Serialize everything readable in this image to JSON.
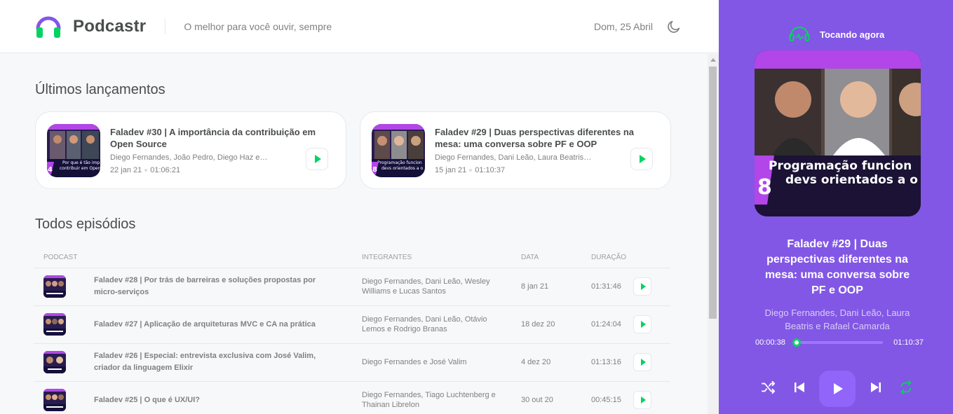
{
  "header": {
    "brand": "Podcastr",
    "tagline": "O melhor para você ouvir, sempre",
    "date": "Dom, 25 Abril",
    "theme_icon": "moon-icon",
    "logo_icon": "headphones-icon"
  },
  "latest": {
    "heading": "Últimos lançamentos",
    "episodes": [
      {
        "title": "Faladev #30 | A importância da contribuição em Open Source",
        "members": "Diego Fernandes, João Pedro, Diego Haz e Bruno Lemos",
        "date": "22 jan 21",
        "duration": "01:06:21",
        "thumb_number": "4"
      },
      {
        "title": "Faladev #29 | Duas perspectivas diferentes na mesa: uma conversa sobre PF e OOP",
        "members": "Diego Fernandes, Dani Leão, Laura Beatris e Rafael Camarda",
        "date": "15 jan 21",
        "duration": "01:10:37",
        "thumb_number": "8"
      }
    ]
  },
  "all": {
    "heading": "Todos episódios",
    "columns": {
      "podcast": "Podcast",
      "members": "Integrantes",
      "date": "Data",
      "duration": "Duração"
    },
    "episodes": [
      {
        "title": "Faladev #28 | Por trás de barreiras e soluções propostas por micro-serviços",
        "members": "Diego Fernandes, Dani Leão, Wesley Williams e Lucas Santos",
        "date": "8 jan 21",
        "duration": "01:31:46"
      },
      {
        "title": "Faladev #27 | Aplicação de arquiteturas MVC e CA na prática",
        "members": "Diego Fernandes, Dani Leão, Otávio Lemos e Rodrigo Branas",
        "date": "18 dez 20",
        "duration": "01:24:04"
      },
      {
        "title": "Faladev #26 | Especial: entrevista exclusiva com José Valim, criador da linguagem Elixir",
        "members": "Diego Fernandes e José Valim",
        "date": "4 dez 20",
        "duration": "01:13:16"
      },
      {
        "title": "Faladev #25 | O que é UX/UI?",
        "members": "Diego Fernandes, Tiago Luchtenberg e Thainan Librelon",
        "date": "30 out 20",
        "duration": "00:45:15"
      }
    ]
  },
  "player": {
    "label": "Tocando agora",
    "cover_text_line1": "Programação funcion",
    "cover_text_line2": "devs orientados a o",
    "cover_number": "8",
    "title": "Faladev #29 | Duas perspectivas diferentes na mesa: uma conversa sobre PF e OOP",
    "members": "Diego Fernandes, Dani Leão, Laura Beatris e Rafael Camarda",
    "current_time": "00:00:38",
    "total_time": "01:10:37",
    "progress_fraction": 0.009,
    "controls": [
      "shuffle-icon",
      "previous-icon",
      "play-icon",
      "next-icon",
      "repeat-icon"
    ]
  },
  "colors": {
    "purple": "#8257e5",
    "green": "#04d361",
    "text": "#494d4b",
    "muted": "#808080"
  }
}
